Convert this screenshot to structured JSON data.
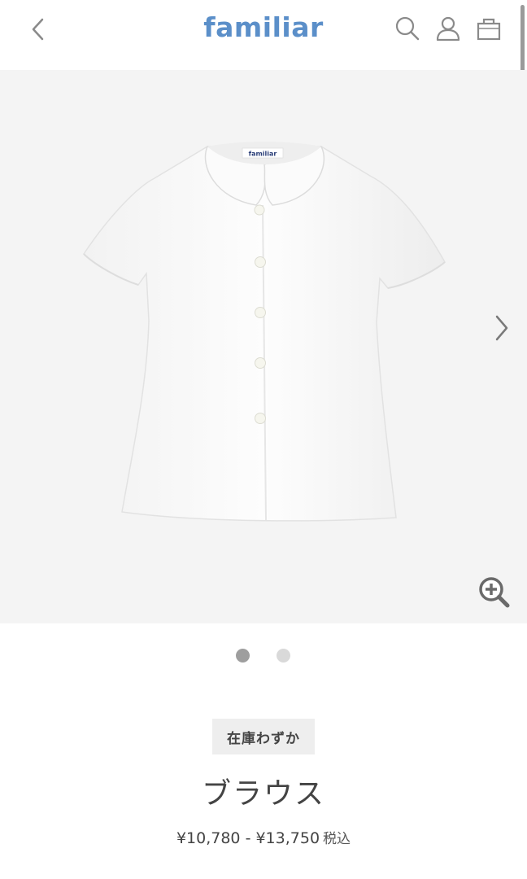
{
  "header": {
    "logo": "familiar",
    "back_icon": "chevron-left-icon",
    "search_icon": "search-icon",
    "account_icon": "user-icon",
    "cart_icon": "shopping-bag-icon"
  },
  "gallery": {
    "image": "white short-sleeve blouse with round collar",
    "neck_label": "familiar",
    "next_icon": "chevron-right-icon",
    "zoom_icon": "zoom-in-icon",
    "current_slide": 1,
    "total_slides": 2
  },
  "product": {
    "stock_badge": "在庫わずか",
    "name": "ブラウス",
    "price_range": "¥10,780 - ¥13,750",
    "tax_label": "税込"
  },
  "colors": {
    "brand": "#5b8fc9",
    "gallery_bg": "#f4f4f4",
    "dot_active": "#9e9e9e",
    "dot_inactive": "#d9d9d9"
  }
}
